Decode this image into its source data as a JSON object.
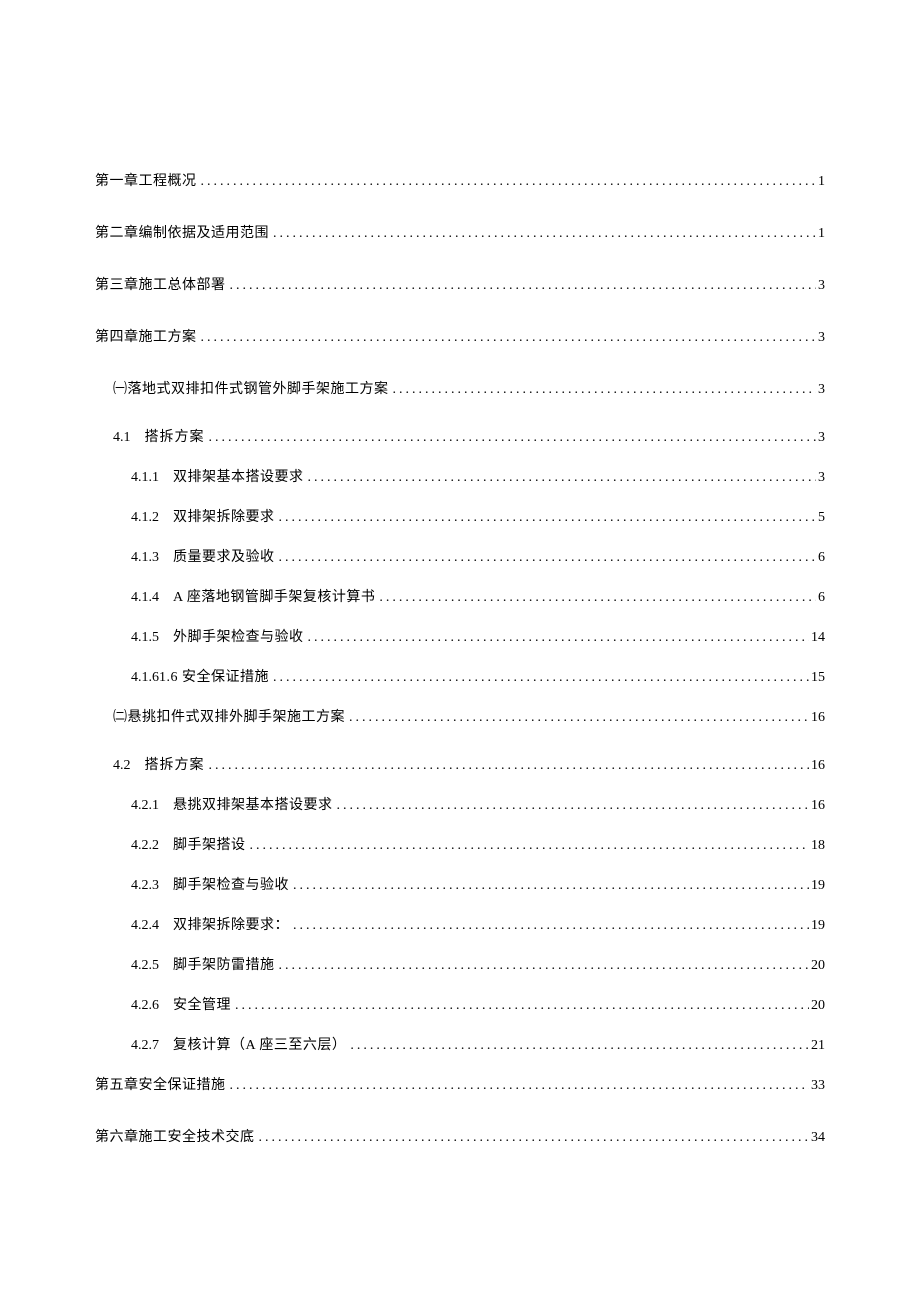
{
  "toc": [
    {
      "level": 1,
      "number": "",
      "title": "第一章工程概况",
      "page": "1"
    },
    {
      "level": 1,
      "number": "",
      "title": "第二章编制依据及适用范围",
      "page": "1"
    },
    {
      "level": 1,
      "number": "",
      "title": "第三章施工总体部署",
      "page": "3"
    },
    {
      "level": 1,
      "number": "",
      "title": "第四章施工方案",
      "page": "3"
    },
    {
      "level": 2,
      "number": "",
      "title": "㈠落地式双排扣件式钢管外脚手架施工方案",
      "page": "3"
    },
    {
      "level": 2,
      "number": "4.1",
      "title": "搭拆方案",
      "page": "3",
      "sub4": true
    },
    {
      "level": 3,
      "number": "4.1.1",
      "title": "双排架基本搭设要求",
      "page": "3"
    },
    {
      "level": 3,
      "number": "4.1.2",
      "title": "双排架拆除要求",
      "page": "5"
    },
    {
      "level": 3,
      "number": "4.1.3",
      "title": "质量要求及验收",
      "page": "6"
    },
    {
      "level": 3,
      "number": "4.1.4",
      "title": "A 座落地钢管脚手架复核计算书",
      "page": "6"
    },
    {
      "level": 3,
      "number": "4.1.5",
      "title": "外脚手架检查与验收",
      "page": "14"
    },
    {
      "level": 3,
      "number": "4.1.6",
      "title": "1.6 安全保证措施",
      "page": "15",
      "nogap": true
    },
    {
      "level": 2,
      "number": "",
      "title": "㈡悬挑扣件式双排外脚手架施工方案",
      "page": "16"
    },
    {
      "level": 2,
      "number": "4.2",
      "title": "搭拆方案",
      "page": "16",
      "sub4": true
    },
    {
      "level": 3,
      "number": "4.2.1",
      "title": "悬挑双排架基本搭设要求",
      "page": "16"
    },
    {
      "level": 3,
      "number": "4.2.2",
      "title": "脚手架搭设",
      "page": "18"
    },
    {
      "level": 3,
      "number": "4.2.3",
      "title": "脚手架检查与验收",
      "page": "19"
    },
    {
      "level": 3,
      "number": "4.2.4",
      "title": "双排架拆除要求：",
      "page": "19"
    },
    {
      "level": 3,
      "number": "4.2.5",
      "title": "脚手架防雷措施",
      "page": "20"
    },
    {
      "level": 3,
      "number": "4.2.6",
      "title": "安全管理",
      "page": "20"
    },
    {
      "level": 3,
      "number": "4.2.7",
      "title": "复核计算（A 座三至六层）",
      "page": "21"
    },
    {
      "level": 1,
      "number": "",
      "title": "第五章安全保证措施",
      "page": "33"
    },
    {
      "level": 1,
      "number": "",
      "title": "第六章施工安全技术交底",
      "page": "34"
    }
  ]
}
